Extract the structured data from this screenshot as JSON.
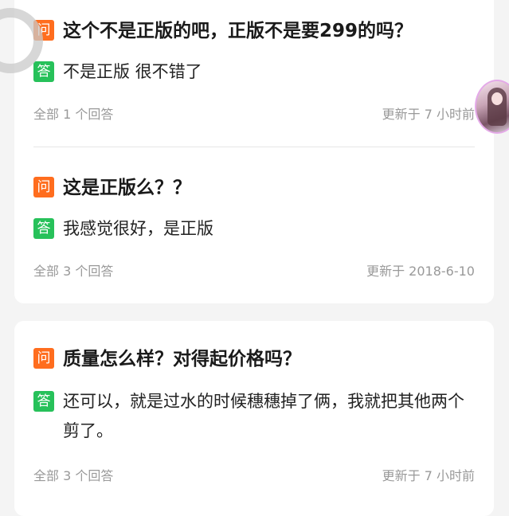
{
  "icons": {
    "question_glyph": "问",
    "answer_glyph": "答"
  },
  "colors": {
    "question_badge": "#ff6d1e",
    "answer_badge": "#27c15a",
    "meta_text": "#999999",
    "background": "#f4f4f4",
    "card": "#ffffff"
  },
  "qa_items": [
    {
      "question": "这个不是正版的吧，正版不是要299的吗？",
      "answer": "不是正版 很不错了",
      "answer_count": "全部 1 个回答",
      "updated": "更新于 7 小时前"
    },
    {
      "question": "这是正版么？？",
      "answer": "我感觉很好，是正版",
      "answer_count": "全部 3 个回答",
      "updated": "更新于 2018-6-10"
    },
    {
      "question": "质量怎么样？对得起价格吗？",
      "answer": "还可以，就是过水的时候穗穗掉了俩，我就把其他两个剪了。",
      "answer_count": "全部 3 个回答",
      "updated": "更新于 7 小时前"
    }
  ]
}
